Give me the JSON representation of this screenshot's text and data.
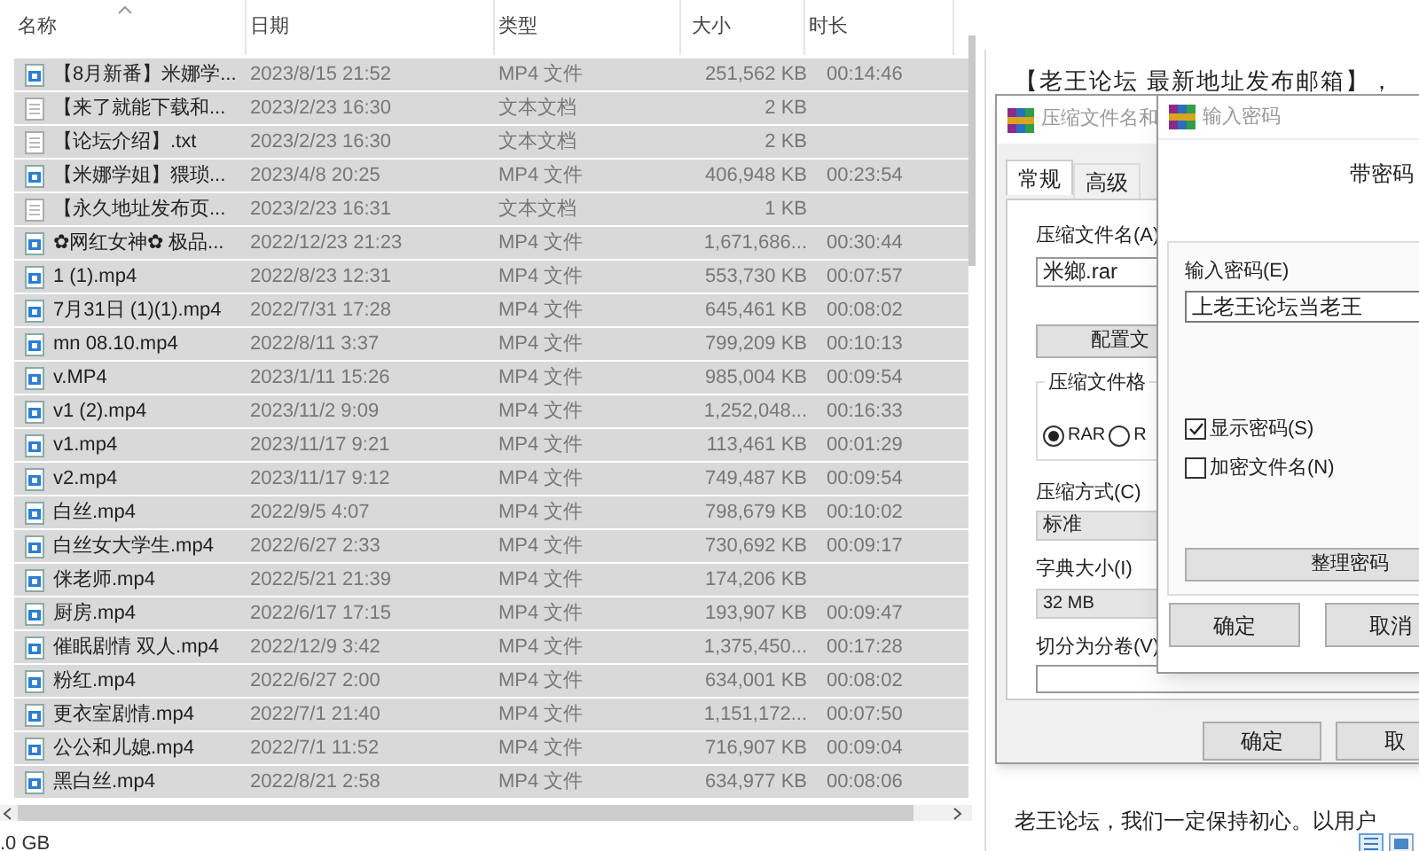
{
  "explorer": {
    "columns": [
      "名称",
      "日期",
      "类型",
      "大小",
      "时长"
    ],
    "rows": [
      {
        "kind": "video",
        "name": "【8月新番】米娜学...",
        "date": "2023/8/15 21:52",
        "type": "MP4 文件",
        "size": "251,562 KB",
        "duration": "00:14:46",
        "selected": true
      },
      {
        "kind": "text",
        "name": "【来了就能下载和...",
        "date": "2023/2/23 16:30",
        "type": "文本文档",
        "size": "2 KB",
        "selected": true
      },
      {
        "kind": "text",
        "name": "【论坛介绍】.txt",
        "date": "2023/2/23 16:30",
        "type": "文本文档",
        "size": "2 KB",
        "selected": true
      },
      {
        "kind": "video",
        "name": "【米娜学姐】猥琐...",
        "date": "2023/4/8 20:25",
        "type": "MP4 文件",
        "size": "406,948 KB",
        "duration": "00:23:54",
        "selected": true
      },
      {
        "kind": "text",
        "name": "【永久地址发布页...",
        "date": "2023/2/23 16:31",
        "type": "文本文档",
        "size": "1 KB",
        "selected": true
      },
      {
        "kind": "video",
        "name": "✿网红女神✿ 极品...",
        "date": "2022/12/23 21:23",
        "type": "MP4 文件",
        "size": "1,671,686...",
        "duration": "00:30:44",
        "selected": true
      },
      {
        "kind": "video",
        "name": "1 (1).mp4",
        "date": "2022/8/23 12:31",
        "type": "MP4 文件",
        "size": "553,730 KB",
        "duration": "00:07:57",
        "selected": true
      },
      {
        "kind": "video",
        "name": "7月31日 (1)(1).mp4",
        "date": "2022/7/31 17:28",
        "type": "MP4 文件",
        "size": "645,461 KB",
        "duration": "00:08:02",
        "selected": true
      },
      {
        "kind": "video",
        "name": "mn 08.10.mp4",
        "date": "2022/8/11 3:37",
        "type": "MP4 文件",
        "size": "799,209 KB",
        "duration": "00:10:13",
        "selected": true
      },
      {
        "kind": "video",
        "name": "v.MP4",
        "date": "2023/1/11 15:26",
        "type": "MP4 文件",
        "size": "985,004 KB",
        "duration": "00:09:54",
        "selected": true
      },
      {
        "kind": "video",
        "name": "v1 (2).mp4",
        "date": "2023/11/2 9:09",
        "type": "MP4 文件",
        "size": "1,252,048...",
        "duration": "00:16:33",
        "selected": true
      },
      {
        "kind": "video",
        "name": "v1.mp4",
        "date": "2023/11/17 9:21",
        "type": "MP4 文件",
        "size": "113,461 KB",
        "duration": "00:01:29",
        "selected": true
      },
      {
        "kind": "video",
        "name": "v2.mp4",
        "date": "2023/11/17 9:12",
        "type": "MP4 文件",
        "size": "749,487 KB",
        "duration": "00:09:54",
        "selected": true
      },
      {
        "kind": "video",
        "name": "白丝.mp4",
        "date": "2022/9/5 4:07",
        "type": "MP4 文件",
        "size": "798,679 KB",
        "duration": "00:10:02",
        "selected": true
      },
      {
        "kind": "video",
        "name": "白丝女大学生.mp4",
        "date": "2022/6/27 2:33",
        "type": "MP4 文件",
        "size": "730,692 KB",
        "duration": "00:09:17",
        "selected": true
      },
      {
        "kind": "video",
        "name": "侎老师.mp4",
        "date": "2022/5/21 21:39",
        "type": "MP4 文件",
        "size": "174,206 KB",
        "selected": true
      },
      {
        "kind": "video",
        "name": "厨房.mp4",
        "date": "2022/6/17 17:15",
        "type": "MP4 文件",
        "size": "193,907 KB",
        "duration": "00:09:47",
        "selected": true
      },
      {
        "kind": "video",
        "name": "催眠剧情 双人.mp4",
        "date": "2022/12/9 3:42",
        "type": "MP4 文件",
        "size": "1,375,450...",
        "duration": "00:17:28",
        "selected": true
      },
      {
        "kind": "video",
        "name": "粉红.mp4",
        "date": "2022/6/27 2:00",
        "type": "MP4 文件",
        "size": "634,001 KB",
        "duration": "00:08:02",
        "selected": true
      },
      {
        "kind": "video",
        "name": "更衣室剧情.mp4",
        "date": "2022/7/1 21:40",
        "type": "MP4 文件",
        "size": "1,151,172...",
        "duration": "00:07:50",
        "selected": true
      },
      {
        "kind": "video",
        "name": "公公和儿媳.mp4",
        "date": "2022/7/1 11:52",
        "type": "MP4 文件",
        "size": "716,907 KB",
        "duration": "00:09:04",
        "selected": true
      },
      {
        "kind": "video",
        "name": "黑白丝.mp4",
        "date": "2022/8/21 2:58",
        "type": "MP4 文件",
        "size": "634,977 KB",
        "duration": "00:08:06",
        "selected": true
      }
    ],
    "status": ".0 GB"
  },
  "document": {
    "lines": [
      "【老王论坛 最新地址发布邮箱】，",
      "老王论坛，我们一定保持初心。以用户"
    ]
  },
  "archive_dialog": {
    "title": "压缩文件名和",
    "tabs": [
      {
        "label": "常规",
        "selected": true
      },
      {
        "label": "高级",
        "selected": false
      }
    ],
    "name_label": "压缩文件名(A)",
    "name_value": "米鄉.rar",
    "profiles_button": "配置文",
    "format_label": "压缩文件格",
    "formats": [
      {
        "label": "RAR",
        "selected": true
      },
      {
        "label": "R",
        "selected": false
      }
    ],
    "method_label": "压缩方式(C)",
    "method_value": "标准",
    "dict_label": "字典大小(I)",
    "dict_value": "32 MB",
    "split_label": "切分为分卷(V)",
    "buttons": [
      "确定",
      "取"
    ]
  },
  "password_dialog": {
    "title": "输入密码",
    "heading": "带密码",
    "password_label": "输入密码(E)",
    "password_value": "上老王论坛当老王",
    "options": [
      {
        "label": "显示密码(S)",
        "checked": true
      },
      {
        "label": "加密文件名(N)",
        "checked": false
      }
    ],
    "organize_button": "整理密码",
    "buttons": [
      "确定",
      "取消"
    ]
  }
}
